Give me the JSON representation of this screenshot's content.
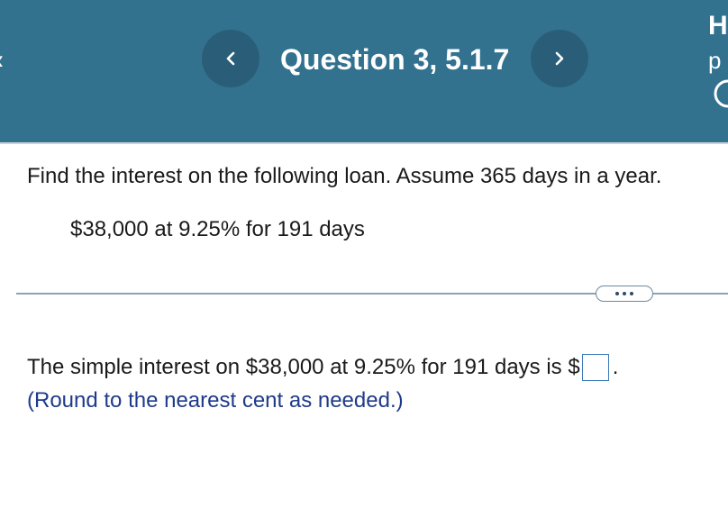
{
  "header": {
    "title": "Question 3, 5.1.7",
    "right_top_letter": "H",
    "right_mid_letters": "p",
    "prev_icon": "chevron-left-icon",
    "next_icon": "chevron-right-icon",
    "background_color": "#32728f",
    "button_color": "#2a5e78"
  },
  "question": {
    "prompt": "Find the interest on the following loan. Assume 365 days in a year.",
    "given": "$38,000 at 9.25% for 191 days"
  },
  "answer": {
    "sentence": "The simple interest on $38,000 at 9.25% for 191 days is $",
    "input_value": "",
    "suffix": ".",
    "hint": "(Round to the nearest cent as needed.)",
    "hint_color": "#1e3a8a"
  }
}
